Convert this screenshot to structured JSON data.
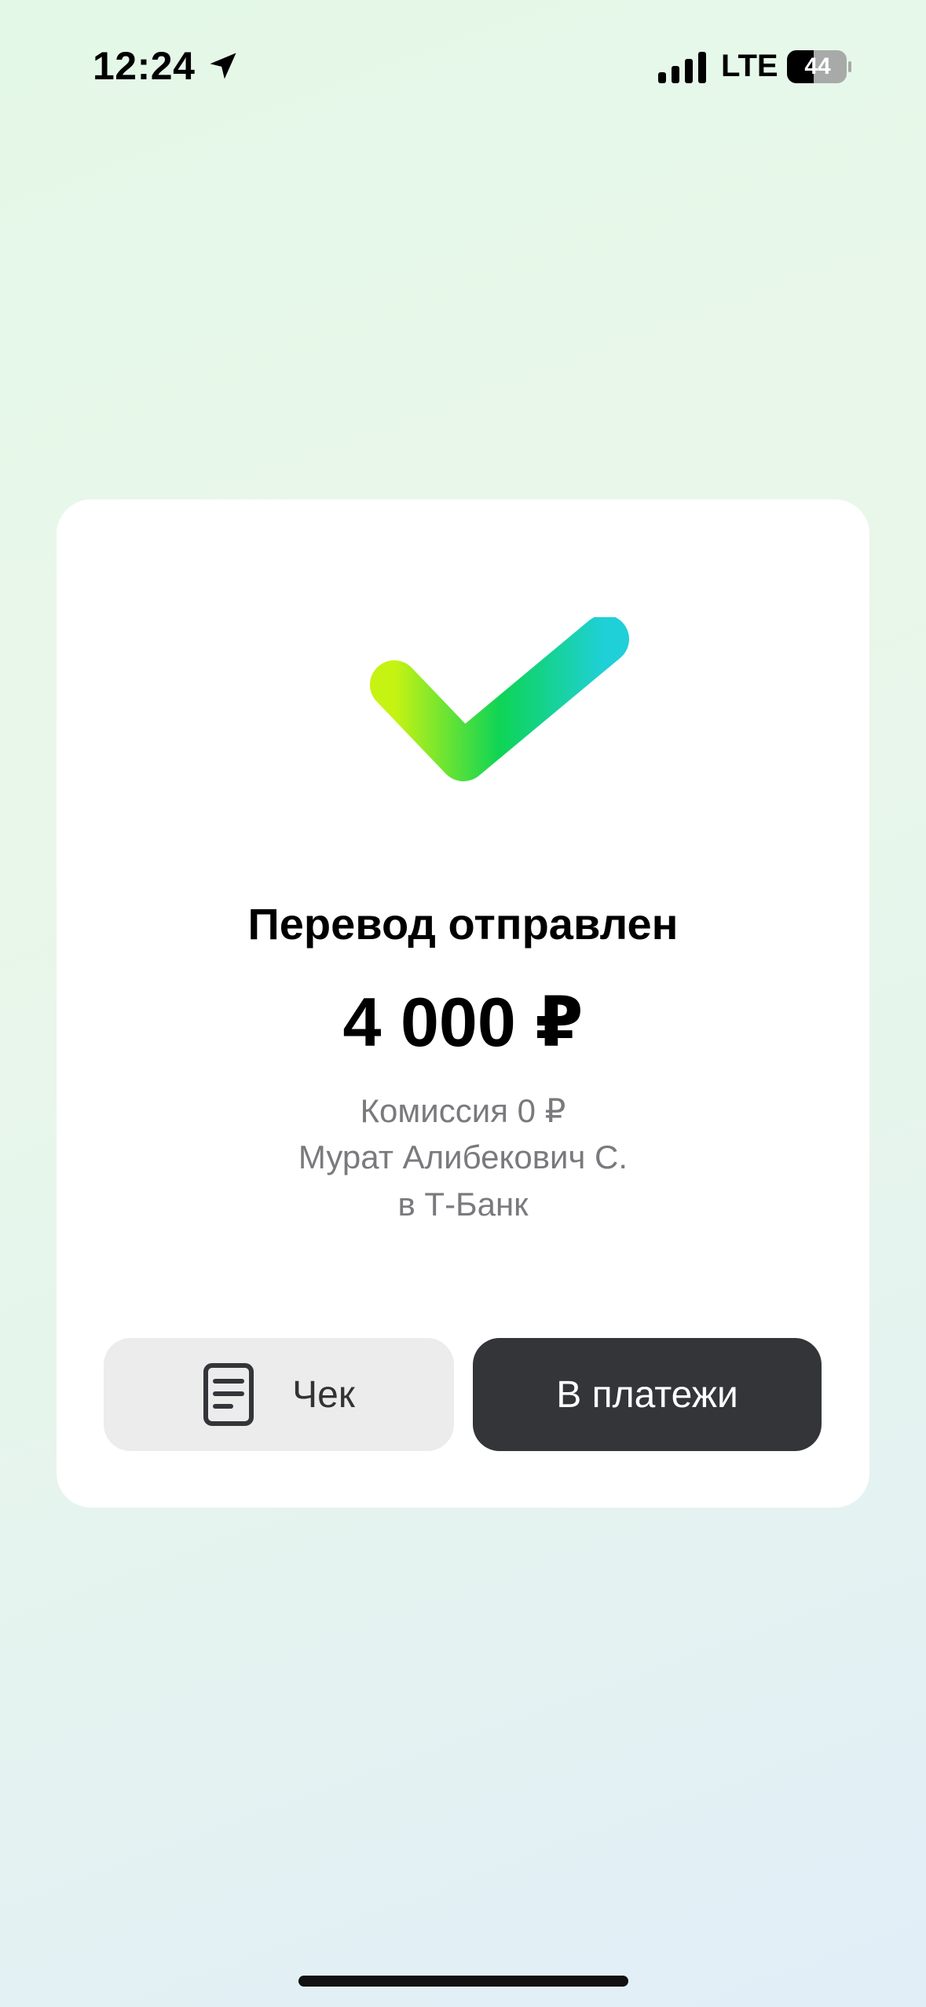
{
  "status_bar": {
    "time": "12:24",
    "network": "LTE",
    "battery": "44",
    "location_icon": "location-arrow-icon",
    "signal_icon": "cellular-signal-icon",
    "battery_icon": "battery-icon"
  },
  "card": {
    "icon": "checkmark-icon",
    "title": "Перевод отправлен",
    "amount": "4 000 ₽",
    "commission": "Комиссия 0 ₽",
    "recipient": "Мурат Алибекович С.",
    "bank": "в Т-Банк"
  },
  "actions": {
    "receipt_label": "Чек",
    "receipt_icon": "receipt-icon",
    "payments_label": "В платежи"
  },
  "colors": {
    "check_gradient_start": "#c6f312",
    "check_gradient_mid": "#0ed455",
    "check_gradient_end": "#1fd0d8",
    "primary_button": "#333539",
    "secondary_button": "#ececed"
  }
}
